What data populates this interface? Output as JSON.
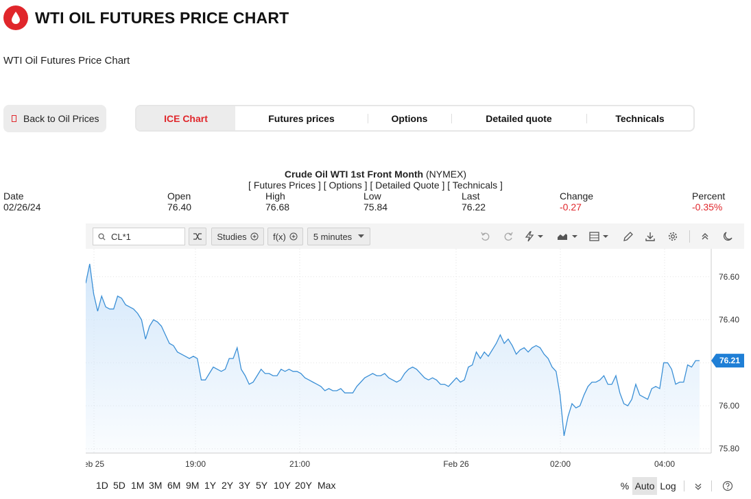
{
  "header": {
    "title": "WTI OIL FUTURES PRICE CHART",
    "icon": "oil-drop-icon",
    "brand_color": "#e0262b"
  },
  "subtitle": "WTI Oil Futures Price Chart",
  "back_button": {
    "label": "Back to Oil Prices"
  },
  "tabs": [
    {
      "label": "ICE Chart",
      "active": true
    },
    {
      "label": "Futures prices",
      "active": false
    },
    {
      "label": "Options",
      "active": false
    },
    {
      "label": "Detailed quote",
      "active": false
    },
    {
      "label": "Technicals",
      "active": false
    }
  ],
  "quote": {
    "instrument": "Crude Oil WTI 1st Front Month",
    "exchange": "(NYMEX)",
    "links": "[ Futures Prices ] [ Options ] [ Detailed Quote ] [ Technicals ]",
    "columns": [
      {
        "label": "Date",
        "value": "02/26/24",
        "negative": false
      },
      {
        "label": "Open",
        "value": "76.40",
        "negative": false
      },
      {
        "label": "High",
        "value": "76.68",
        "negative": false
      },
      {
        "label": "Low",
        "value": "75.84",
        "negative": false
      },
      {
        "label": "Last",
        "value": "76.22",
        "negative": false
      },
      {
        "label": "Change",
        "value": "-0.27",
        "negative": true
      },
      {
        "label": "Percent",
        "value": "-0.35%",
        "negative": true
      }
    ]
  },
  "toolbar": {
    "symbol_value": "CL*1",
    "studies_label": "Studies",
    "fx_label": "f(x)",
    "interval_label": "5 minutes",
    "icons": [
      "search-icon",
      "shuffle-icon",
      "undo-icon",
      "redo-icon",
      "lightning-icon",
      "chart-type-icon",
      "layout-icon",
      "pencil-icon",
      "download-icon",
      "gear-icon",
      "collapse-icon",
      "moon-icon"
    ]
  },
  "chart_data": {
    "type": "area",
    "series": [
      {
        "values": [
          76.57,
          76.66,
          76.52,
          76.44,
          76.51,
          76.46,
          76.45,
          76.45,
          76.51,
          76.5,
          76.47,
          76.46,
          76.45,
          76.43,
          76.4,
          76.31,
          76.37,
          76.4,
          76.39,
          76.37,
          76.33,
          76.29,
          76.28,
          76.25,
          76.24,
          76.23,
          76.22,
          76.23,
          76.22,
          76.12,
          76.12,
          76.15,
          76.18,
          76.17,
          76.16,
          76.17,
          76.22,
          76.22,
          76.27,
          76.17,
          76.14,
          76.1,
          76.11,
          76.14,
          76.17,
          76.15,
          76.15,
          76.14,
          76.14,
          76.17,
          76.16,
          76.17,
          76.16,
          76.16,
          76.15,
          76.13,
          76.12,
          76.11,
          76.1,
          76.09,
          76.07,
          76.08,
          76.07,
          76.07,
          76.08,
          76.06,
          76.06,
          76.06,
          76.09,
          76.11,
          76.13,
          76.14,
          76.15,
          76.14,
          76.14,
          76.15,
          76.13,
          76.12,
          76.11,
          76.12,
          76.15,
          76.17,
          76.18,
          76.17,
          76.15,
          76.13,
          76.12,
          76.13,
          76.12,
          76.1,
          76.1,
          76.09,
          76.11,
          76.13,
          76.11,
          76.12,
          76.18,
          76.19,
          76.25,
          76.22,
          76.25,
          76.23,
          76.26,
          76.29,
          76.33,
          76.29,
          76.31,
          76.28,
          76.24,
          76.26,
          76.27,
          76.25,
          76.27,
          76.28,
          76.27,
          76.24,
          76.22,
          76.18,
          76.16,
          76.05,
          75.86,
          75.95,
          76.01,
          75.99,
          76.0,
          76.05,
          76.09,
          76.11,
          76.11,
          76.12,
          76.14,
          76.1,
          76.1,
          76.14,
          76.06,
          76.01,
          76.0,
          76.03,
          76.1,
          76.05,
          76.04,
          76.03,
          76.08,
          76.09,
          76.08,
          76.2,
          76.2,
          76.17,
          76.1,
          76.11,
          76.11,
          76.19,
          76.18,
          76.21,
          76.21
        ]
      }
    ],
    "x_ticks": [
      "eb 25",
      "19:00",
      "21:00",
      "Feb 26",
      "02:00",
      "04:00"
    ],
    "y_ticks": [
      "76.60",
      "76.40",
      "76.20",
      "76.00",
      "75.80"
    ],
    "ylim": [
      75.78,
      76.73
    ],
    "last_value_label": "76.21",
    "line_color": "#3a8fd6",
    "fill_color": "#d6e9fb",
    "grid": true
  },
  "timeframes": [
    "1D",
    "5D",
    "1M",
    "3M",
    "6M",
    "9M",
    "1Y",
    "2Y",
    "3Y",
    "5Y",
    "10Y",
    "20Y",
    "Max"
  ],
  "scale_options": {
    "percent": "%",
    "auto": "Auto",
    "log": "Log"
  }
}
